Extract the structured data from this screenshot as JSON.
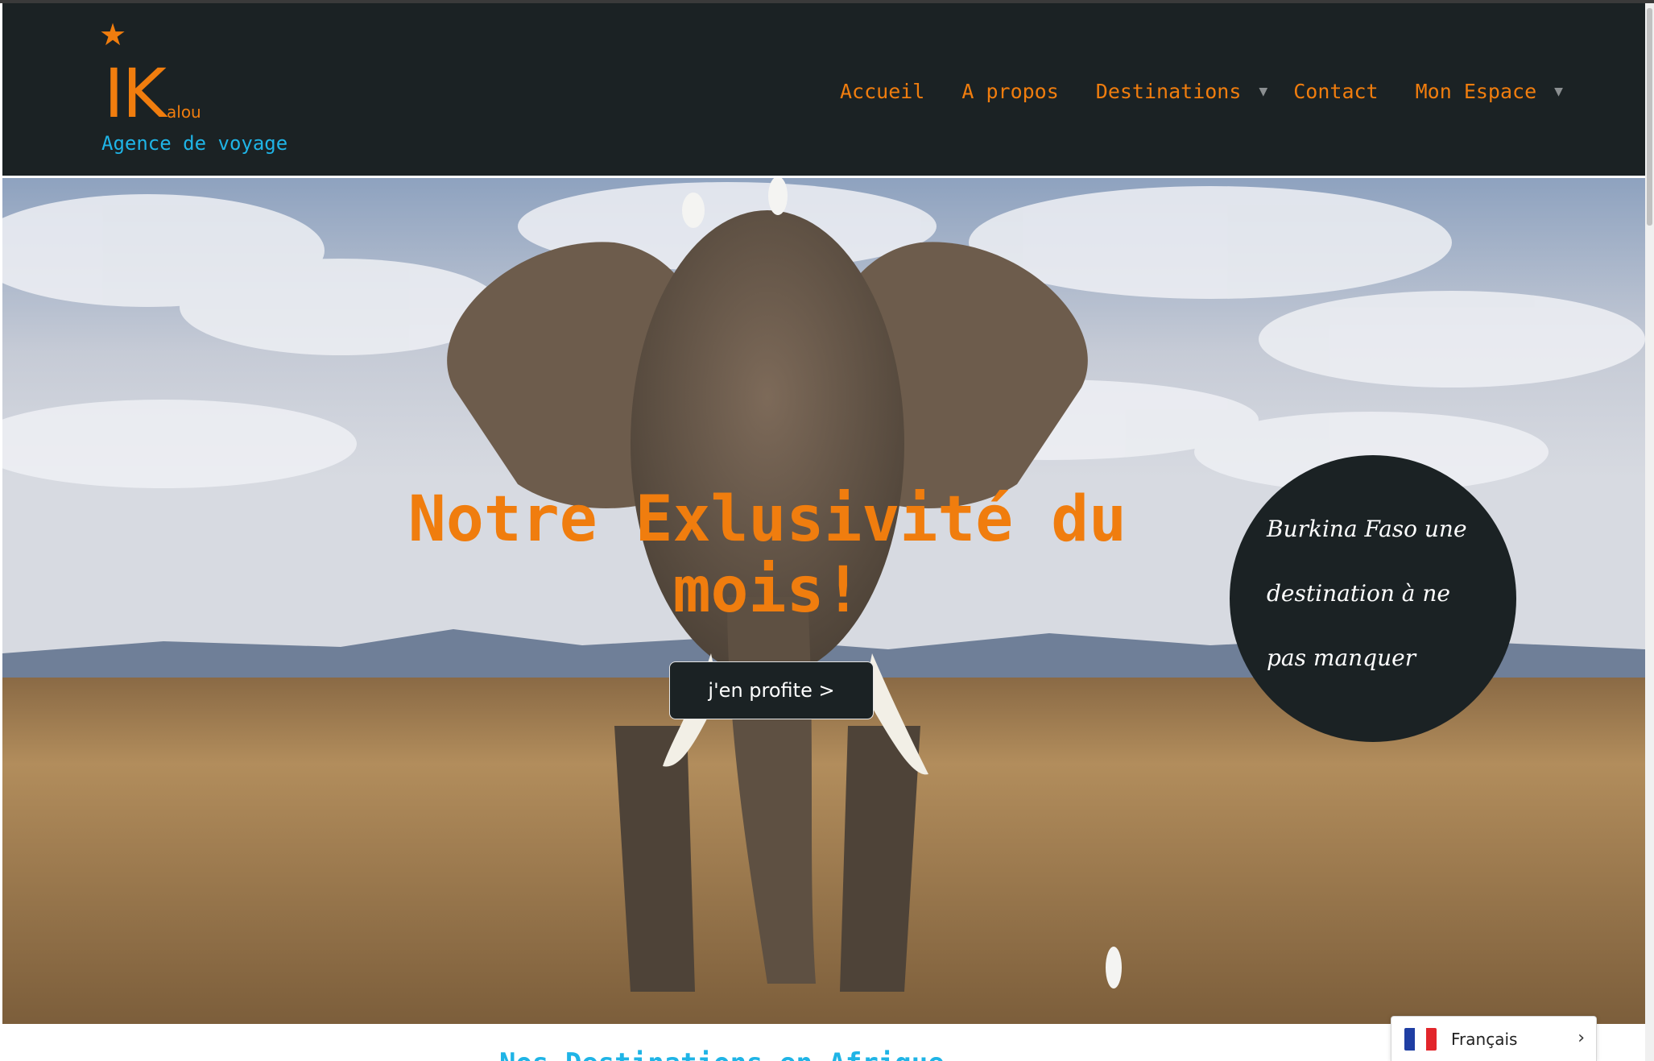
{
  "header": {
    "logo": {
      "star": "★",
      "initials": "IK",
      "suffix": "alou",
      "tagline": "Agence de voyage"
    },
    "nav": [
      {
        "label": "Accueil",
        "has_dropdown": false
      },
      {
        "label": "A propos",
        "has_dropdown": false
      },
      {
        "label": "Destinations",
        "has_dropdown": true
      },
      {
        "label": "Contact",
        "has_dropdown": false
      },
      {
        "label": "Mon Espace",
        "has_dropdown": true
      }
    ],
    "caret": "▼"
  },
  "hero": {
    "title": "Notre Exlusivité du mois!",
    "cta_label": "j'en profite >",
    "promo_text": "Burkina Faso une destination à ne pas manquer",
    "image_subject": "elephant-in-savanna"
  },
  "next_section_heading": "Nos Destinations en Afrique",
  "language_widget": {
    "label": "Français",
    "chevron": "›",
    "flag_colors": [
      "#1f3ea3",
      "#ffffff",
      "#e2252b"
    ]
  },
  "colors": {
    "brand_orange": "#f07d0e",
    "brand_blue": "#1fb4e6",
    "header_bg": "#1b2224"
  }
}
